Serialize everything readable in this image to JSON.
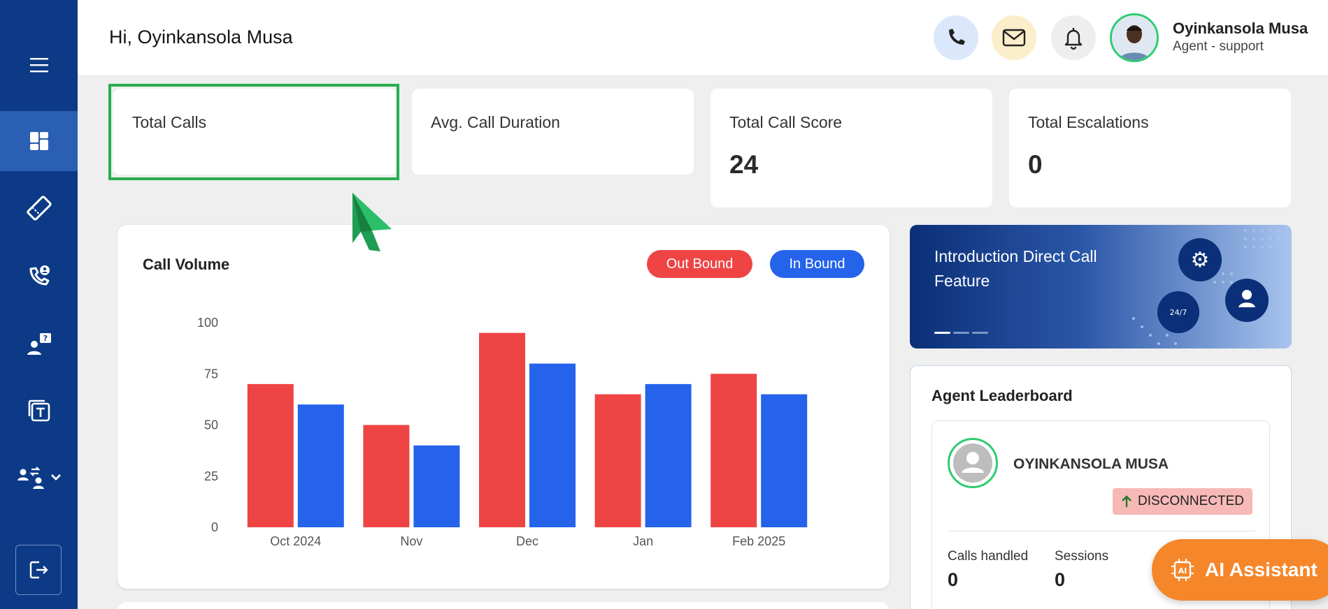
{
  "header": {
    "greeting": "Hi, Oyinkansola Musa",
    "user_name": "Oyinkansola Musa",
    "user_role": "Agent - support",
    "icons": [
      "phone-icon",
      "mail-icon",
      "bell-icon"
    ]
  },
  "sidebar": {
    "items": [
      {
        "name": "menu-icon"
      },
      {
        "name": "dashboard-icon",
        "active": true
      },
      {
        "name": "ticket-icon"
      },
      {
        "name": "call-agent-icon"
      },
      {
        "name": "support-question-icon"
      },
      {
        "name": "template-icon"
      },
      {
        "name": "transfer-users-icon"
      }
    ],
    "logout_icon": "logout-icon"
  },
  "stats": [
    {
      "label": "Total Calls",
      "value": ""
    },
    {
      "label": "Avg. Call Duration",
      "value": ""
    },
    {
      "label": "Total Call Score",
      "value": "24"
    },
    {
      "label": "Total Escalations",
      "value": "0"
    }
  ],
  "chart": {
    "title": "Call Volume",
    "legend_outbound": "Out Bound",
    "legend_inbound": "In Bound"
  },
  "chart_data": {
    "type": "bar",
    "title": "Call Volume",
    "categories": [
      "Oct 2024",
      "Nov",
      "Dec",
      "Jan",
      "Feb 2025"
    ],
    "series": [
      {
        "name": "Out Bound",
        "values": [
          70,
          50,
          95,
          65,
          75
        ],
        "color": "#ef4444"
      },
      {
        "name": "In Bound",
        "values": [
          60,
          40,
          80,
          70,
          65
        ],
        "color": "#2563eb"
      }
    ],
    "yticks": [
      0,
      25,
      50,
      75,
      100
    ],
    "ylim": [
      0,
      100
    ],
    "grid": false,
    "legend_position": "top-right"
  },
  "promo": {
    "text": "Introduction Direct Call Feature",
    "badge": "24/7"
  },
  "leaderboard": {
    "title": "Agent Leaderboard",
    "agent_name": "OYINKANSOLA MUSA",
    "status": "DISCONNECTED",
    "calls_handled_label": "Calls handled",
    "calls_handled_value": "0",
    "sessions_label": "Sessions",
    "sessions_value": "0"
  },
  "ai_assistant": {
    "label": "AI Assistant"
  },
  "colors": {
    "sidebar": "#0c3a86",
    "sidebar_active": "#2b5fb4",
    "outbound": "#ef4444",
    "inbound": "#2563eb",
    "highlight": "#27ae4f",
    "ai_button": "#f5862a"
  }
}
